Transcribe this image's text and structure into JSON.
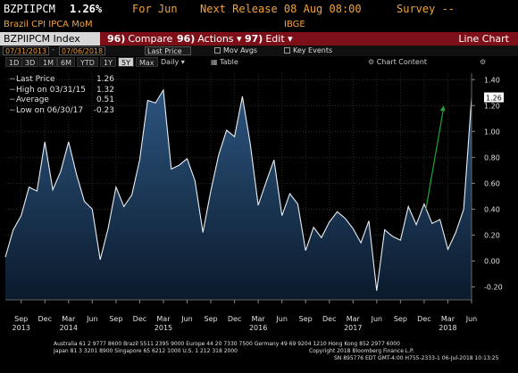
{
  "header": {
    "ticker": "BZPIIPCM",
    "value": "1.26%",
    "for_period": "For Jun",
    "next_release": "Next Release 08 Aug 08:00",
    "survey": "Survey --",
    "subtitle": "Brazil CPI IPCA MoM",
    "source": "IBGE"
  },
  "toolbar": {
    "index_label": "BZPIIPCM Index",
    "compare": {
      "num": "96)",
      "label": "Compare"
    },
    "actions": {
      "num": "96)",
      "label": "Actions ▾"
    },
    "edit": {
      "num": "97)",
      "label": "Edit ▾"
    },
    "chart_type": "Line Chart"
  },
  "date_row": {
    "start_date": "07/31/2013",
    "end_date": "07/06/2018",
    "field": "Last Price",
    "mov_avgs": "Mov Avgs",
    "key_events": "Key Events"
  },
  "periods": {
    "items": [
      "1D",
      "3D",
      "1M",
      "6M",
      "YTD",
      "1Y",
      "5Y"
    ],
    "selected": "5Y",
    "max_label": "Max",
    "frequency": "Daily ▾",
    "table_label": "Table",
    "chart_content": "Chart Content"
  },
  "legend": {
    "last_price": {
      "label": "Last Price",
      "value": "1.26"
    },
    "high": {
      "label": "High on 03/31/15",
      "value": "1.32"
    },
    "average": {
      "label": "Average",
      "value": "0.51"
    },
    "low": {
      "label": "Low on 06/30/17",
      "value": "-0.23"
    }
  },
  "last_value_tag": "1.26",
  "colors": {
    "toolbar_bg": "#7d0f18",
    "accent_orange": "#f3a23a",
    "series_fill": "#1b3a5c",
    "series_line": "#e8eef5",
    "arrow": "#1fa53a"
  },
  "footer": {
    "line1": "Australia 61 2 9777 8600 Brazil 5511 2395 9000 Europe 44 20 7330 7500 Germany 49 69 9204 1210 Hong Kong 852 2977 6000",
    "line2": "Japan 81 3 3201 8900          Singapore 65 6212 1000          U.S. 1 212 318 2000",
    "line2b": "Copyright 2018 Bloomberg Finance L.P.",
    "line3": "SN 895776 EDT  GMT-4:00 H755-2333-1 06-Jul-2018 10:13:25"
  },
  "chart_data": {
    "type": "area",
    "title": "",
    "ylim": [
      -0.3,
      1.45
    ],
    "yticks": [
      -0.2,
      0.0,
      0.2,
      0.4,
      0.6,
      0.8,
      1.0,
      1.2,
      1.4
    ],
    "ytick_labels": [
      "-0.20",
      "0.00",
      "0.20",
      "0.40",
      "0.60",
      "0.80",
      "1.00",
      "1.20",
      "1.40"
    ],
    "x_month_ticks": [
      "Sep",
      "Dec",
      "Mar",
      "Jun",
      "Sep",
      "Dec",
      "Mar",
      "Jun",
      "Sep",
      "Dec",
      "Mar",
      "Jun",
      "Sep",
      "Dec",
      "Mar",
      "Jun",
      "Sep",
      "Dec",
      "Mar",
      "Jun"
    ],
    "x_years": [
      "2013",
      "2014",
      "2015",
      "2016",
      "2017",
      "2018"
    ],
    "x": [
      "2013-07",
      "2013-08",
      "2013-09",
      "2013-10",
      "2013-11",
      "2013-12",
      "2014-01",
      "2014-02",
      "2014-03",
      "2014-04",
      "2014-05",
      "2014-06",
      "2014-07",
      "2014-08",
      "2014-09",
      "2014-10",
      "2014-11",
      "2014-12",
      "2015-01",
      "2015-02",
      "2015-03",
      "2015-04",
      "2015-05",
      "2015-06",
      "2015-07",
      "2015-08",
      "2015-09",
      "2015-10",
      "2015-11",
      "2015-12",
      "2016-01",
      "2016-02",
      "2016-03",
      "2016-04",
      "2016-05",
      "2016-06",
      "2016-07",
      "2016-08",
      "2016-09",
      "2016-10",
      "2016-11",
      "2016-12",
      "2017-01",
      "2017-02",
      "2017-03",
      "2017-04",
      "2017-05",
      "2017-06",
      "2017-07",
      "2017-08",
      "2017-09",
      "2017-10",
      "2017-11",
      "2017-12",
      "2018-01",
      "2018-02",
      "2018-03",
      "2018-04",
      "2018-05",
      "2018-06"
    ],
    "series": [
      {
        "values": [
          0.03,
          0.24,
          0.35,
          0.57,
          0.54,
          0.92,
          0.55,
          0.69,
          0.92,
          0.67,
          0.46,
          0.4,
          0.01,
          0.25,
          0.57,
          0.42,
          0.51,
          0.78,
          1.24,
          1.22,
          1.32,
          0.71,
          0.74,
          0.79,
          0.62,
          0.22,
          0.54,
          0.82,
          1.01,
          0.96,
          1.27,
          0.9,
          0.43,
          0.61,
          0.78,
          0.35,
          0.52,
          0.44,
          0.08,
          0.26,
          0.18,
          0.3,
          0.38,
          0.33,
          0.25,
          0.14,
          0.31,
          -0.23,
          0.24,
          0.19,
          0.16,
          0.42,
          0.28,
          0.44,
          0.29,
          0.32,
          0.09,
          0.22,
          0.4,
          1.26
        ]
      }
    ],
    "last_price": 1.26,
    "high": 1.32,
    "average": 0.51,
    "low": -0.23
  }
}
